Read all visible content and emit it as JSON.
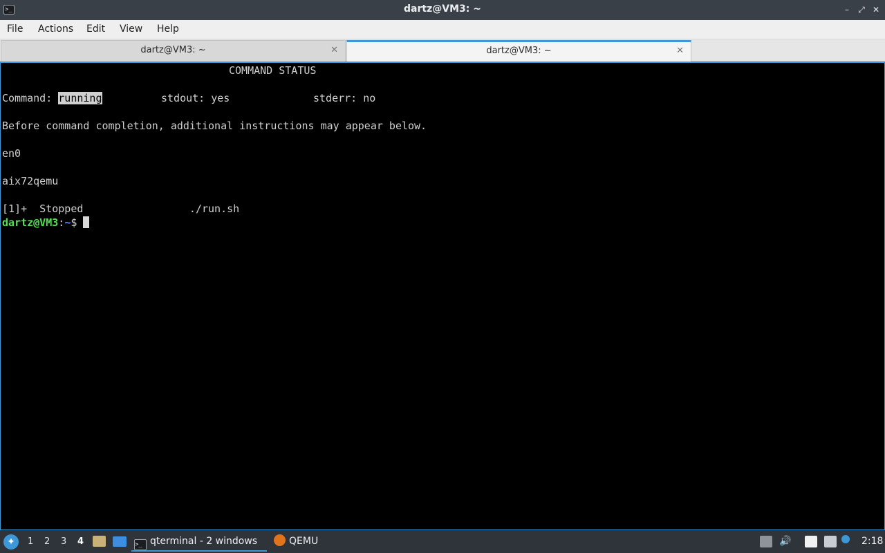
{
  "window": {
    "title": "dartz@VM3: ~",
    "app_icon": "terminal-icon",
    "controls": {
      "minimize": "–",
      "maximize": "⤢",
      "close": "✕"
    }
  },
  "menubar": [
    "File",
    "Actions",
    "Edit",
    "View",
    "Help"
  ],
  "tabs": [
    {
      "label": "dartz@VM3: ~",
      "active": false
    },
    {
      "label": "dartz@VM3: ~",
      "active": true
    }
  ],
  "terminal": {
    "heading": "COMMAND STATUS",
    "command_label": "Command: ",
    "command_state": "running",
    "stdout": "stdout: yes",
    "stderr": "stderr: no",
    "instructions": "Before command completion, additional instructions may appear below.",
    "line_en0": "en0",
    "line_host": "aix72qemu",
    "job_line": "[1]+  Stopped                 ./run.sh",
    "prompt_user": "dartz@VM3",
    "prompt_sep": ":",
    "prompt_path": "~",
    "prompt_symbol": "$ "
  },
  "taskbar": {
    "start_icon": "start-menu-icon",
    "workspaces": [
      "1",
      "2",
      "3",
      "4"
    ],
    "current_workspace": "4",
    "tasks": [
      {
        "label": "qterminal - 2 windows",
        "icon": "terminal-icon",
        "active": true
      },
      {
        "label": "QEMU",
        "icon": "qemu-icon",
        "active": false
      }
    ],
    "clock": "2:18"
  },
  "colors": {
    "accent": "#3d98d8",
    "terminal_bg": "#000000",
    "terminal_fg": "#d0d0d0",
    "prompt_user": "#55e055",
    "prompt_path": "#5c8cff"
  }
}
